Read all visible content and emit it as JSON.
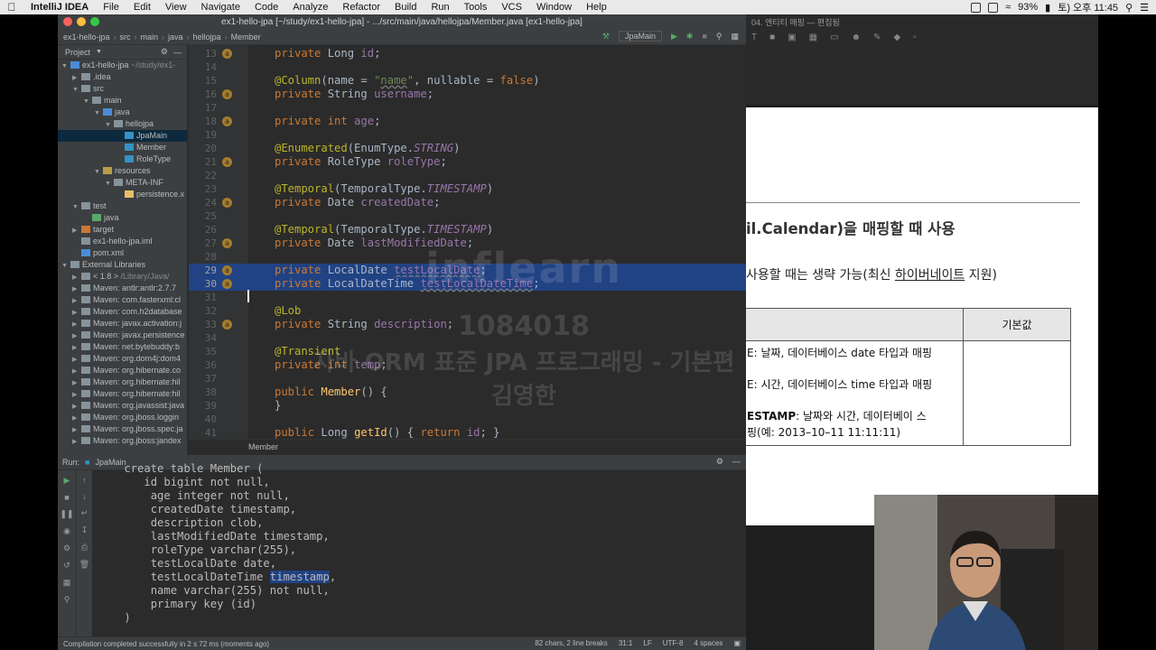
{
  "menubar": {
    "app_name": "IntelliJ IDEA",
    "items": [
      "File",
      "Edit",
      "View",
      "Navigate",
      "Code",
      "Analyze",
      "Refactor",
      "Build",
      "Run",
      "Tools",
      "VCS",
      "Window",
      "Help"
    ],
    "battery": "93%",
    "clock": "토) 오후 11:45"
  },
  "ide": {
    "window_title": "ex1-hello-jpa [~/study/ex1-hello-jpa] - .../src/main/java/hellojpa/Member.java [ex1-hello-jpa]",
    "breadcrumbs": [
      "ex1-hello-jpa",
      "src",
      "main",
      "java",
      "hellojpa",
      "Member"
    ],
    "run_config": "JpaMain",
    "project_panel_title": "Project",
    "tree": [
      {
        "label": "ex1-hello-jpa",
        "extra": "~/study/ex1-",
        "depth": 0,
        "arrow": "▼",
        "color": "#4a8cd8"
      },
      {
        "label": ".idea",
        "depth": 1,
        "arrow": "▶",
        "color": "#87939a"
      },
      {
        "label": "src",
        "depth": 1,
        "arrow": "▼",
        "color": "#87939a"
      },
      {
        "label": "main",
        "depth": 2,
        "arrow": "▼",
        "color": "#87939a"
      },
      {
        "label": "java",
        "depth": 3,
        "arrow": "▼",
        "color": "#4a8cd8"
      },
      {
        "label": "hellojpa",
        "depth": 4,
        "arrow": "▼",
        "color": "#87939a"
      },
      {
        "label": "JpaMain",
        "depth": 5,
        "arrow": "",
        "color": "#3592c4",
        "selected": true
      },
      {
        "label": "Member",
        "depth": 5,
        "arrow": "",
        "color": "#3592c4"
      },
      {
        "label": "RoleType",
        "depth": 5,
        "arrow": "",
        "color": "#3592c4"
      },
      {
        "label": "resources",
        "depth": 3,
        "arrow": "▼",
        "color": "#b69d4a"
      },
      {
        "label": "META-INF",
        "depth": 4,
        "arrow": "▼",
        "color": "#87939a"
      },
      {
        "label": "persistence.x",
        "depth": 5,
        "arrow": "",
        "color": "#e8bf6a"
      },
      {
        "label": "test",
        "depth": 1,
        "arrow": "▼",
        "color": "#87939a"
      },
      {
        "label": "java",
        "depth": 2,
        "arrow": "",
        "color": "#59a869"
      },
      {
        "label": "target",
        "depth": 1,
        "arrow": "▶",
        "color": "#cc7832"
      },
      {
        "label": "ex1-hello-jpa.iml",
        "depth": 1,
        "arrow": "",
        "color": "#87939a"
      },
      {
        "label": "pom.xml",
        "depth": 1,
        "arrow": "",
        "color": "#4a8cd8"
      },
      {
        "label": "External Libraries",
        "depth": 0,
        "arrow": "▼",
        "color": "#87939a"
      },
      {
        "label": "< 1.8 >",
        "extra": "/Library/Java/",
        "depth": 1,
        "arrow": "▶",
        "color": "#87939a"
      },
      {
        "label": "Maven: antlr:antlr:2.7.7",
        "depth": 1,
        "arrow": "▶",
        "color": "#87939a"
      },
      {
        "label": "Maven: com.fasterxml:cl",
        "depth": 1,
        "arrow": "▶",
        "color": "#87939a"
      },
      {
        "label": "Maven: com.h2database",
        "depth": 1,
        "arrow": "▶",
        "color": "#87939a"
      },
      {
        "label": "Maven: javax.activation:j",
        "depth": 1,
        "arrow": "▶",
        "color": "#87939a"
      },
      {
        "label": "Maven: javax.persistence",
        "depth": 1,
        "arrow": "▶",
        "color": "#87939a"
      },
      {
        "label": "Maven: net.bytebuddy:b",
        "depth": 1,
        "arrow": "▶",
        "color": "#87939a"
      },
      {
        "label": "Maven: org.dom4j:dom4",
        "depth": 1,
        "arrow": "▶",
        "color": "#87939a"
      },
      {
        "label": "Maven: org.hibernate.co",
        "depth": 1,
        "arrow": "▶",
        "color": "#87939a"
      },
      {
        "label": "Maven: org.hibernate:hil",
        "depth": 1,
        "arrow": "▶",
        "color": "#87939a"
      },
      {
        "label": "Maven: org.hibernate:hil",
        "depth": 1,
        "arrow": "▶",
        "color": "#87939a"
      },
      {
        "label": "Maven: org.javassist:java",
        "depth": 1,
        "arrow": "▶",
        "color": "#87939a"
      },
      {
        "label": "Maven: org.jboss.loggin",
        "depth": 1,
        "arrow": "▶",
        "color": "#87939a"
      },
      {
        "label": "Maven: org.jboss.spec.ja",
        "depth": 1,
        "arrow": "▶",
        "color": "#87939a"
      },
      {
        "label": "Maven: org.jboss:jandex",
        "depth": 1,
        "arrow": "▶",
        "color": "#87939a"
      }
    ],
    "editor_lines": [
      {
        "n": "13",
        "mark": true,
        "html": "<span class=\"kw\">private</span> Long <span class=\"fld\">id</span>;"
      },
      {
        "n": "14",
        "mark": false,
        "html": ""
      },
      {
        "n": "15",
        "mark": false,
        "html": "<span class=\"ann\">@Column</span>(name = <span class=\"str\">\"<span class=\"wavy\" style=\"color:#6a8759\">name</span>\"</span>, nullable = <span class=\"kw\">false</span>)"
      },
      {
        "n": "16",
        "mark": true,
        "html": "<span class=\"kw\">private</span> String <span class=\"fld\">username</span>;"
      },
      {
        "n": "17",
        "mark": false,
        "html": ""
      },
      {
        "n": "18",
        "mark": true,
        "html": "<span class=\"kw\">private int</span> <span class=\"fld\">age</span>;"
      },
      {
        "n": "19",
        "mark": false,
        "html": ""
      },
      {
        "n": "20",
        "mark": false,
        "html": "<span class=\"ann\">@Enumerated</span>(EnumType.<span class=\"ital\">STRING</span>)"
      },
      {
        "n": "21",
        "mark": true,
        "html": "<span class=\"kw\">private</span> RoleType <span class=\"fld\">roleType</span>;"
      },
      {
        "n": "22",
        "mark": false,
        "html": ""
      },
      {
        "n": "23",
        "mark": false,
        "html": "<span class=\"ann\">@Temporal</span>(TemporalType.<span class=\"ital\">TIMESTAMP</span>)"
      },
      {
        "n": "24",
        "mark": true,
        "html": "<span class=\"kw\">private</span> Date <span class=\"fld\">createdDate</span>;"
      },
      {
        "n": "25",
        "mark": false,
        "html": ""
      },
      {
        "n": "26",
        "mark": false,
        "html": "<span class=\"ann\">@Temporal</span>(TemporalType.<span class=\"ital\">TIMESTAMP</span>)"
      },
      {
        "n": "27",
        "mark": true,
        "html": "<span class=\"kw\">private</span> Date <span class=\"fld\">lastModifiedDate</span>;"
      },
      {
        "n": "28",
        "mark": false,
        "html": ""
      },
      {
        "n": "29",
        "mark": true,
        "sel": true,
        "html": "<span class=\"kw\">private</span> LocalDate <span class=\"wavyF\">testLocalDate</span>;"
      },
      {
        "n": "30",
        "mark": true,
        "sel": true,
        "html": "<span class=\"kw\">private</span> LocalDateTime <span class=\"wavyF\">testLocalDateTime</span>;"
      },
      {
        "n": "31",
        "mark": false,
        "html": ""
      },
      {
        "n": "32",
        "mark": false,
        "html": "<span class=\"ann\">@Lob</span>"
      },
      {
        "n": "33",
        "mark": true,
        "html": "<span class=\"kw\">private</span> String <span class=\"fld\">description</span>;"
      },
      {
        "n": "34",
        "mark": false,
        "html": ""
      },
      {
        "n": "35",
        "mark": false,
        "html": "<span class=\"ann\">@Transient</span>"
      },
      {
        "n": "36",
        "mark": false,
        "html": "<span class=\"kw\">private int</span> <span class=\"fld\">temp</span>;"
      },
      {
        "n": "37",
        "mark": false,
        "html": ""
      },
      {
        "n": "38",
        "mark": false,
        "html": "<span class=\"kw\">public</span> <span style=\"color:#ffc66d\">Member</span>() {"
      },
      {
        "n": "39",
        "mark": false,
        "html": "}"
      },
      {
        "n": "40",
        "mark": false,
        "html": ""
      },
      {
        "n": "41",
        "mark": false,
        "html": "<span class=\"kw\">public</span> Long <span style=\"color:#ffc66d\">getId</span>() { <span class=\"kw\">return</span> <span class=\"fld\">id</span>; }"
      }
    ],
    "editor_footer": "Member",
    "run_panel": {
      "title": "Run:",
      "tab": "JpaMain",
      "console_lines": [
        "    create table Member (",
        "       id bigint not null,",
        "        age integer not null,",
        "        createdDate timestamp,",
        "        description clob,",
        "        lastModifiedDate timestamp,",
        "        roleType varchar(255),",
        "        testLocalDate date,",
        "        testLocalDateTime ",
        "        name varchar(255) not null,",
        "        primary key (id)",
        "    )"
      ],
      "highlight_word": "timestamp",
      "highlight_suffix": ","
    },
    "status": {
      "message": "Compilation completed successfully in 2 s 72 ms (moments ago)",
      "selection": "82 chars, 2 line breaks",
      "position": "31:1",
      "line_sep": "LF",
      "encoding": "UTF-8",
      "indent": "4 spaces"
    }
  },
  "watermark": {
    "brand": "inflearn",
    "id": "1084018",
    "course": "자바 ORM 표준 JPA 프로그래밍 - 기본편",
    "name": "김영한"
  },
  "slides": {
    "window_title": "04. 엔티티 매핑 — 편집됨",
    "heading": "il.Calendar)을 매핑할 때 사용",
    "line2_pre": "사용할 때는 생략 가능(최신 ",
    "line2_u": "하이버네이트",
    "line2_post": " 지원)",
    "table_header_default": "기본값",
    "row1": "E: 날짜, 데이터베이스 date 타입과 매핑",
    "row2": "E: 시간, 데이터베이스 time 타입과 매핑",
    "row3_bold": "ESTAMP",
    "row3_rest": ": 날짜와 시간, 데이터베이 스",
    "row4": "핑(예: 2013–10–11 11:11:11)"
  }
}
